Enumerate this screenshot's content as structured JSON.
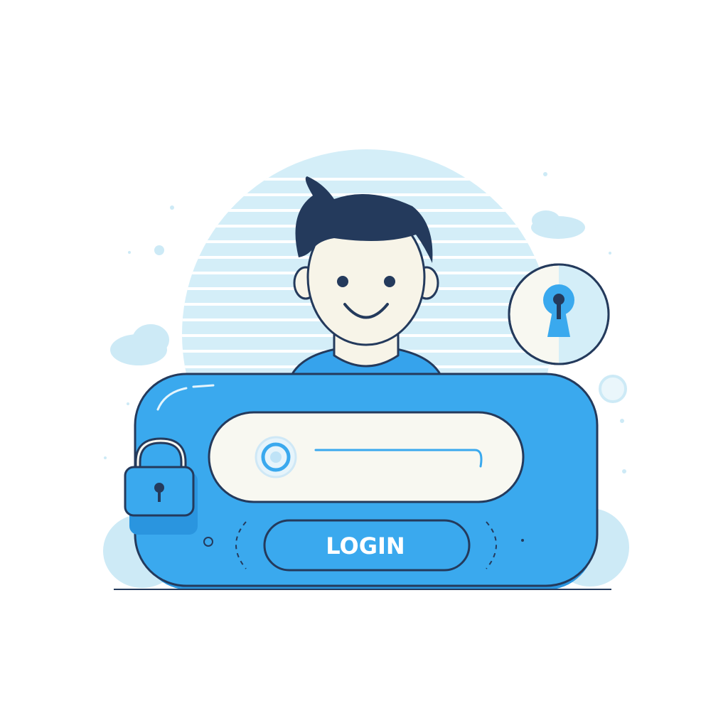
{
  "colors": {
    "background": "#ffffff",
    "backdrop": "#d4eef8",
    "backdrop_stripe": "#ffffff",
    "cloud": "#cdeaf6",
    "panel": "#3aa9ee",
    "panel_dark": "#2a95df",
    "input_bg": "#f8f8f1",
    "outline": "#243a5c",
    "hair": "#243a5c",
    "skin": "#f7f4e8",
    "shirt": "#36a3ec",
    "lock_badge_bg": "#f8f8f1",
    "login_text": "#ffffff"
  },
  "login_button": {
    "label": "LOGIN"
  },
  "icons": {
    "avatar": "smiling-person-avatar",
    "lock": "padlock-icon",
    "keyhole": "keyhole-icon",
    "input_field_icon": "circle-icon"
  }
}
